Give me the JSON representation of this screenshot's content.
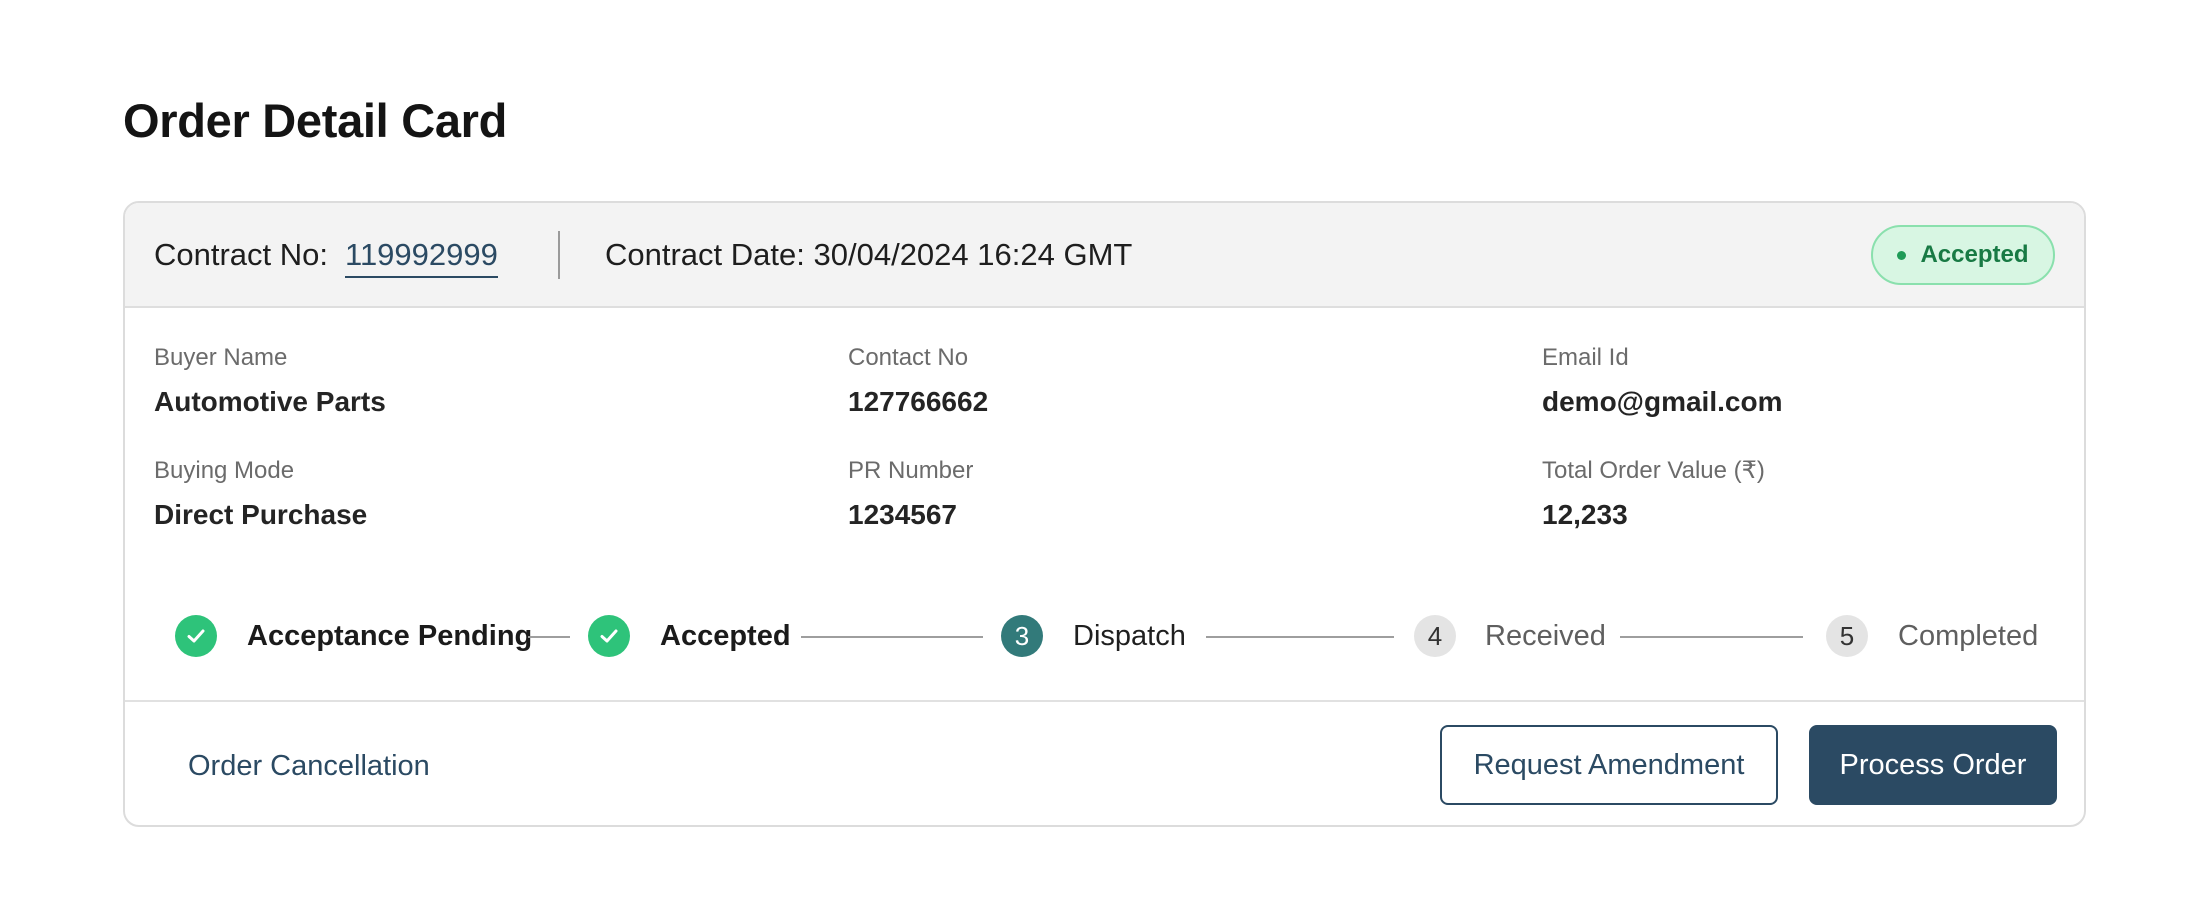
{
  "page": {
    "title": "Order Detail Card"
  },
  "header": {
    "contract_no_label": "Contract No:",
    "contract_no": "119992999",
    "contract_date_label": "Contract Date:",
    "contract_date": "30/04/2024 16:24 GMT",
    "status": "Accepted",
    "colors": {
      "status_bg": "#d8f6e3",
      "status_text": "#187a44"
    }
  },
  "fields": {
    "buyer_name": {
      "label": "Buyer Name",
      "value": "Automotive Parts"
    },
    "contact_no": {
      "label": "Contact No",
      "value": "127766662"
    },
    "email_id": {
      "label": "Email Id",
      "value": "demo@gmail.com"
    },
    "buying_mode": {
      "label": "Buying Mode",
      "value": "Direct Purchase"
    },
    "pr_number": {
      "label": "PR Number",
      "value": "1234567"
    },
    "total_order_value": {
      "label": "Total Order Value (₹)",
      "value": "12,233"
    }
  },
  "stepper": {
    "steps": [
      {
        "label": "Acceptance Pending",
        "state": "done",
        "number": "1",
        "icon": "check-icon"
      },
      {
        "label": "Accepted",
        "state": "done",
        "number": "2",
        "icon": "check-icon"
      },
      {
        "label": "Dispatch",
        "state": "active",
        "number": "3"
      },
      {
        "label": "Received",
        "state": "todo",
        "number": "4"
      },
      {
        "label": "Completed",
        "state": "todo",
        "number": "5"
      }
    ]
  },
  "actions": {
    "cancel_label": "Order Cancellation",
    "amend_label": "Request Amendment",
    "process_label": "Process Order",
    "colors": {
      "primary": "#2b4a63",
      "done": "#2ec37a",
      "active": "#327a7a"
    }
  }
}
